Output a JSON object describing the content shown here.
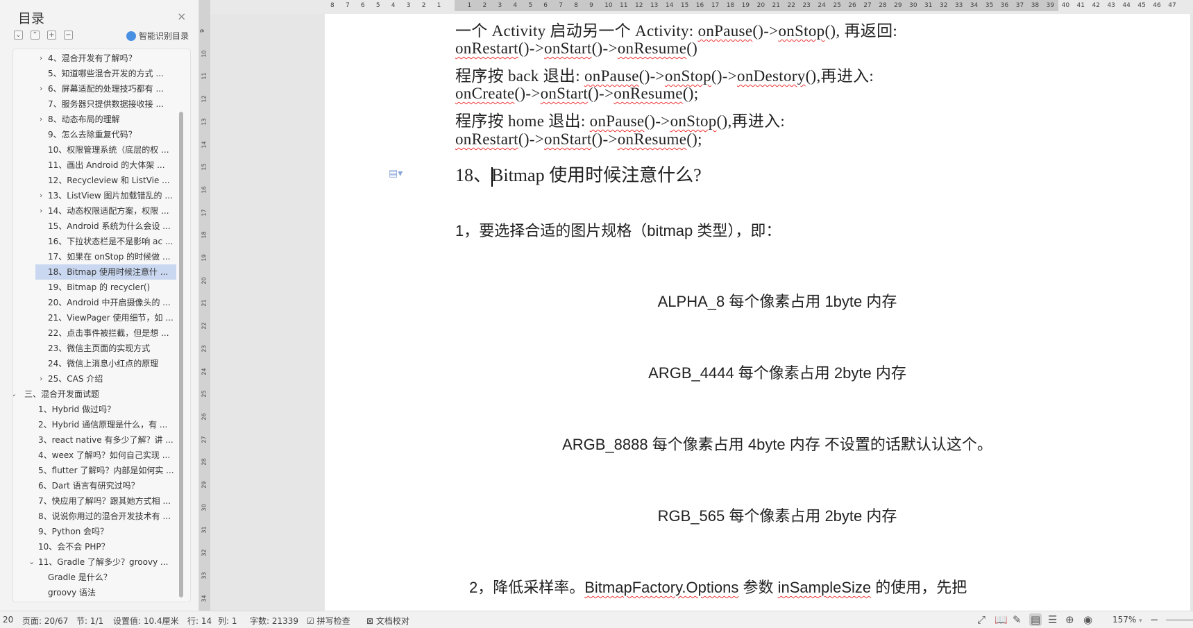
{
  "panel": {
    "title": "目录",
    "close": "×",
    "tools": [
      "⌄",
      "⌃",
      "+",
      "−"
    ],
    "smart_label": "智能识别目录",
    "items": [
      {
        "label": "4、混合开发有了解吗？",
        "arrow": "›",
        "level": 2
      },
      {
        "label": "5、知道哪些混合开发的方式 ...",
        "arrow": "",
        "level": 2
      },
      {
        "label": "6、屏幕适配的处理技巧都有 ...",
        "arrow": "›",
        "level": 2
      },
      {
        "label": "7、服务器只提供数据接收接 ...",
        "arrow": "",
        "level": 2
      },
      {
        "label": "8、动态布局的理解",
        "arrow": "›",
        "level": 2
      },
      {
        "label": "9、怎么去除重复代码？",
        "arrow": "",
        "level": 2
      },
      {
        "label": "10、权限管理系统（底层的权 ...",
        "arrow": "",
        "level": 2
      },
      {
        "label": "11、画出 Android 的大体架 ...",
        "arrow": "",
        "level": 2
      },
      {
        "label": "12、Recycleview 和 ListVie ...",
        "arrow": "",
        "level": 2
      },
      {
        "label": "13、ListView 图片加载错乱的 ...",
        "arrow": "›",
        "level": 2
      },
      {
        "label": "14、动态权限适配方案，权限 ...",
        "arrow": "›",
        "level": 2
      },
      {
        "label": "15、Android 系统为什么会设 ...",
        "arrow": "",
        "level": 2
      },
      {
        "label": "16、下拉状态栏是不是影响 ac ...",
        "arrow": "",
        "level": 2
      },
      {
        "label": "17、如果在 onStop 的时候做 ...",
        "arrow": "",
        "level": 2
      },
      {
        "label": "18、Bitmap  使用时候注意什 ...",
        "arrow": "",
        "level": 2,
        "selected": true
      },
      {
        "label": "19、Bitmap 的 recycler()",
        "arrow": "",
        "level": 2
      },
      {
        "label": "20、Android 中开启摄像头的 ...",
        "arrow": "",
        "level": 2
      },
      {
        "label": "21、ViewPager 使用细节，如 ...",
        "arrow": "",
        "level": 2
      },
      {
        "label": "22、点击事件被拦截，但是想 ...",
        "arrow": "",
        "level": 2
      },
      {
        "label": "23、微信主页面的实现方式",
        "arrow": "",
        "level": 2
      },
      {
        "label": "24、微信上消息小红点的原理",
        "arrow": "",
        "level": 2
      },
      {
        "label": "25、CAS 介绍",
        "arrow": "›",
        "level": 2
      },
      {
        "label": "三、混合开发面试题",
        "arrow": "⌄",
        "level": 0
      },
      {
        "label": "1、Hybrid 做过吗？",
        "arrow": "",
        "level": 1
      },
      {
        "label": "2、Hybrid 通信原理是什么，有 ...",
        "arrow": "",
        "level": 1
      },
      {
        "label": "3、react native 有多少了解？讲 ...",
        "arrow": "",
        "level": 1
      },
      {
        "label": "4、weex 了解吗？如何自己实现 ...",
        "arrow": "",
        "level": 1
      },
      {
        "label": "5、flutter 了解吗？内部是如何实 ...",
        "arrow": "",
        "level": 1
      },
      {
        "label": "6、Dart 语言有研究过吗？",
        "arrow": "",
        "level": 1
      },
      {
        "label": "7、快应用了解吗？跟其她方式相 ...",
        "arrow": "",
        "level": 1
      },
      {
        "label": "8、说说你用过的混合开发技术有 ...",
        "arrow": "",
        "level": 1
      },
      {
        "label": "9、Python 会吗？",
        "arrow": "",
        "level": 1
      },
      {
        "label": "10、会不会 PHP？",
        "arrow": "",
        "level": 1
      },
      {
        "label": "11、Gradle 了解多少？groovy ...",
        "arrow": "⌄",
        "level": 1
      },
      {
        "label": "Gradle  是什么？",
        "arrow": "",
        "level": 2
      },
      {
        "label": "groovy 语法",
        "arrow": "",
        "level": 2
      }
    ]
  },
  "vruler": [
    "9",
    "10",
    "11",
    "12",
    "13",
    "14",
    "15",
    "16",
    "17",
    "18",
    "19",
    "20",
    "21",
    "22",
    "23",
    "24",
    "25",
    "26",
    "27",
    "28",
    "29",
    "30",
    "31",
    "32",
    "33",
    "34"
  ],
  "hruler": [
    "8",
    "7",
    "6",
    "5",
    "4",
    "3",
    "2",
    "1",
    "",
    "1",
    "2",
    "3",
    "4",
    "5",
    "6",
    "7",
    "8",
    "9",
    "10",
    "11",
    "12",
    "13",
    "14",
    "15",
    "16",
    "17",
    "18",
    "19",
    "20",
    "21",
    "22",
    "23",
    "24",
    "25",
    "26",
    "27",
    "28",
    "29",
    "30",
    "31",
    "32",
    "33",
    "34",
    "35",
    "36",
    "37",
    "38",
    "39",
    "40",
    "41",
    "42",
    "43",
    "44",
    "45",
    "46",
    "47"
  ],
  "doc": {
    "lines": [
      [
        {
          "t": "一个 Activity 启动另一个 Activity: "
        },
        {
          "t": "onPause",
          "s": 1
        },
        {
          "t": "()->"
        },
        {
          "t": "onStop",
          "s": 1
        },
        {
          "t": "(), 再返回:"
        }
      ],
      [
        {
          "t": "onRestart",
          "s": 1
        },
        {
          "t": "()->"
        },
        {
          "t": "onStart",
          "s": 1
        },
        {
          "t": "()->"
        },
        {
          "t": "onResume",
          "s": 1
        },
        {
          "t": "()"
        }
      ],
      [
        {
          "t": "程序按 back 退出:  "
        },
        {
          "t": "onPause",
          "s": 1
        },
        {
          "t": "()->"
        },
        {
          "t": "onStop",
          "s": 1
        },
        {
          "t": "()->"
        },
        {
          "t": "onDestory",
          "s": 1
        },
        {
          "t": "(),再进入:"
        }
      ],
      [
        {
          "t": "onCreate",
          "s": 1
        },
        {
          "t": "()->"
        },
        {
          "t": "onStart",
          "s": 1
        },
        {
          "t": "()->"
        },
        {
          "t": "onResume",
          "s": 1
        },
        {
          "t": "();"
        }
      ],
      [
        {
          "t": "程序按 home 退出:  "
        },
        {
          "t": "onPause",
          "s": 1
        },
        {
          "t": "()->"
        },
        {
          "t": "onStop",
          "s": 1
        },
        {
          "t": "(),再进入:"
        }
      ],
      [
        {
          "t": "onRestart",
          "s": 1
        },
        {
          "t": "()->"
        },
        {
          "t": "onStart",
          "s": 1
        },
        {
          "t": "()->"
        },
        {
          "t": "onResume",
          "s": 1
        },
        {
          "t": "();"
        }
      ]
    ],
    "heading_prefix": "18、",
    "heading_rest": "Bitmap 使用时候注意什么?",
    "para1": "1，要选择合适的图片规格（bitmap 类型），即：",
    "formats": [
      "ALPHA_8   每个像素占用 1byte 内存",
      "ARGB_4444  每个像素占用 2byte 内存",
      "ARGB_8888  每个像素占用 4byte 内存   不设置的话默认认这个。",
      "RGB_565  每个像素占用 2byte 内存"
    ],
    "para2_a": "2，降低采样率。",
    "para2_b": "BitmapFactory.Options",
    "para2_c": " 参数 ",
    "para2_d": "inSampleSize",
    "para2_e": " 的使用，先把"
  },
  "status": {
    "page_num": "20",
    "page": "页面: 20/67",
    "section": "节: 1/1",
    "setting": "设置值: 10.4厘米",
    "row": "行: 14",
    "col": "列: 1",
    "words": "字数: 21339",
    "spell": "拼写检查",
    "proof": "文档校对",
    "zoom": "157%",
    "zoom_arrow": "▾"
  }
}
